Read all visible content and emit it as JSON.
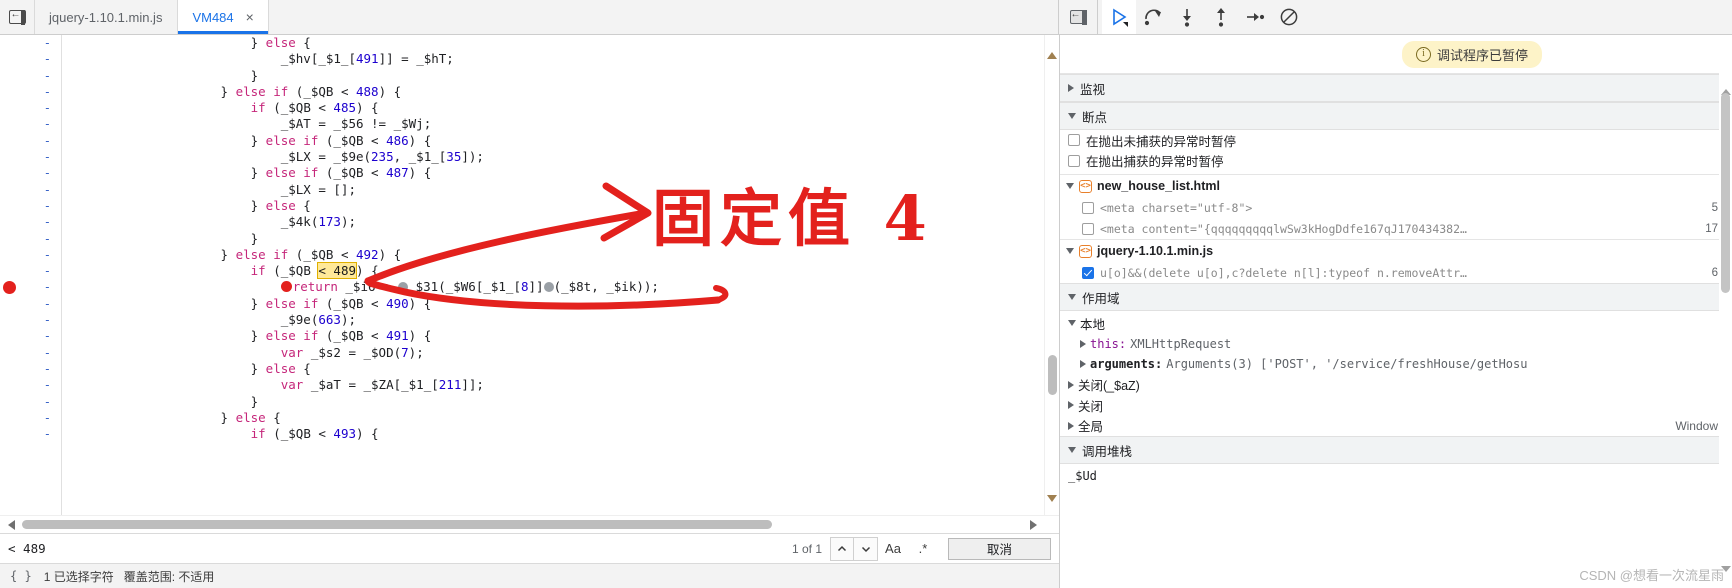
{
  "topbar": {
    "back_icon": "back-to-previous-icon",
    "tabs": [
      {
        "label": "jquery-1.10.1.min.js",
        "active": false,
        "closable": false
      },
      {
        "label": "VM484",
        "active": true,
        "closable": true,
        "close_label": "×"
      }
    ],
    "panel_toggle_icon": "show-navigator-icon",
    "debug_buttons": [
      {
        "name": "resume-script-execution",
        "icon": "play-pause-icon",
        "selected": true
      },
      {
        "name": "step-over-next-function-call",
        "icon": "step-over-icon",
        "selected": false
      },
      {
        "name": "step-into-next-function-call",
        "icon": "step-into-icon",
        "selected": false
      },
      {
        "name": "step-out-of-current-function",
        "icon": "step-out-icon",
        "selected": false
      },
      {
        "name": "step",
        "icon": "step-icon",
        "selected": false
      },
      {
        "name": "deactivate-breakpoints",
        "icon": "deactivate-breakpoints-icon",
        "selected": false
      }
    ]
  },
  "editor": {
    "lines": [
      {
        "gutter": "-",
        "segments": [
          {
            "t": "                        } ",
            "c": "punct"
          },
          {
            "t": "else",
            "c": "kw2"
          },
          {
            "t": " {",
            "c": "punct"
          }
        ]
      },
      {
        "gutter": "-",
        "segments": [
          {
            "t": "                            _$hv[_$1_[",
            "c": "punct"
          },
          {
            "t": "491",
            "c": "num"
          },
          {
            "t": "]] = _$hT;",
            "c": "punct"
          }
        ]
      },
      {
        "gutter": "-",
        "segments": [
          {
            "t": "                        }",
            "c": "punct"
          }
        ]
      },
      {
        "gutter": "-",
        "segments": [
          {
            "t": "                    } ",
            "c": "punct"
          },
          {
            "t": "else if",
            "c": "kw2"
          },
          {
            "t": " (_$QB < ",
            "c": "punct"
          },
          {
            "t": "488",
            "c": "num"
          },
          {
            "t": ") {",
            "c": "punct"
          }
        ]
      },
      {
        "gutter": "-",
        "segments": [
          {
            "t": "                        ",
            "c": "punct"
          },
          {
            "t": "if",
            "c": "kw2"
          },
          {
            "t": " (_$QB < ",
            "c": "punct"
          },
          {
            "t": "485",
            "c": "num"
          },
          {
            "t": ") {",
            "c": "punct"
          }
        ]
      },
      {
        "gutter": "-",
        "segments": [
          {
            "t": "                            _$AT = _$56 != _$Wj;",
            "c": "punct"
          }
        ]
      },
      {
        "gutter": "-",
        "segments": [
          {
            "t": "                        } ",
            "c": "punct"
          },
          {
            "t": "else if",
            "c": "kw2"
          },
          {
            "t": " (_$QB < ",
            "c": "punct"
          },
          {
            "t": "486",
            "c": "num"
          },
          {
            "t": ") {",
            "c": "punct"
          }
        ]
      },
      {
        "gutter": "-",
        "segments": [
          {
            "t": "                            _$LX = _$9e(",
            "c": "punct"
          },
          {
            "t": "235",
            "c": "num"
          },
          {
            "t": ", _$1_[",
            "c": "punct"
          },
          {
            "t": "35",
            "c": "num"
          },
          {
            "t": "]);",
            "c": "punct"
          }
        ]
      },
      {
        "gutter": "-",
        "segments": [
          {
            "t": "                        } ",
            "c": "punct"
          },
          {
            "t": "else if",
            "c": "kw2"
          },
          {
            "t": " (_$QB < ",
            "c": "punct"
          },
          {
            "t": "487",
            "c": "num"
          },
          {
            "t": ") {",
            "c": "punct"
          }
        ]
      },
      {
        "gutter": "-",
        "segments": [
          {
            "t": "                            _$LX = [];",
            "c": "punct"
          }
        ]
      },
      {
        "gutter": "-",
        "segments": [
          {
            "t": "                        } ",
            "c": "punct"
          },
          {
            "t": "else",
            "c": "kw2"
          },
          {
            "t": " {",
            "c": "punct"
          }
        ]
      },
      {
        "gutter": "-",
        "segments": [
          {
            "t": "                            _$4k(",
            "c": "punct"
          },
          {
            "t": "173",
            "c": "num"
          },
          {
            "t": ");",
            "c": "punct"
          }
        ]
      },
      {
        "gutter": "-",
        "segments": [
          {
            "t": "                        }",
            "c": "punct"
          }
        ]
      },
      {
        "gutter": "-",
        "segments": [
          {
            "t": "                    } ",
            "c": "punct"
          },
          {
            "t": "else if",
            "c": "kw2"
          },
          {
            "t": " (_$QB < ",
            "c": "punct"
          },
          {
            "t": "492",
            "c": "num"
          },
          {
            "t": ") {",
            "c": "punct"
          }
        ]
      },
      {
        "gutter": "-",
        "segments": [
          {
            "t": "                        ",
            "c": "punct"
          },
          {
            "t": "if",
            "c": "kw2"
          },
          {
            "t": " (_$QB ",
            "c": "punct"
          },
          {
            "t": "< 489",
            "c": "hl-search"
          },
          {
            "t": ") {",
            "c": "punct"
          }
        ]
      },
      {
        "gutter": "-",
        "breakpoint": true,
        "segments": [
          {
            "t": "                            ",
            "c": "punct"
          },
          {
            "t": "BPDOT",
            "c": "bpdot"
          },
          {
            "t": "return",
            "c": "ret"
          },
          {
            "t": " _$i6 + ",
            "c": "punct"
          },
          {
            "t": "DOT",
            "c": "dot"
          },
          {
            "t": "_$31(_$W6[_$1_[",
            "c": "punct"
          },
          {
            "t": "8",
            "c": "num"
          },
          {
            "t": "]]",
            "c": "punct"
          },
          {
            "t": "DOT",
            "c": "dot"
          },
          {
            "t": "(_$8t, _$ik));",
            "c": "punct"
          }
        ]
      },
      {
        "gutter": "-",
        "segments": [
          {
            "t": "                        } ",
            "c": "punct"
          },
          {
            "t": "else if",
            "c": "kw2"
          },
          {
            "t": " (_$QB < ",
            "c": "punct"
          },
          {
            "t": "490",
            "c": "num"
          },
          {
            "t": ") {",
            "c": "punct"
          }
        ]
      },
      {
        "gutter": "-",
        "segments": [
          {
            "t": "                            _$9e(",
            "c": "punct"
          },
          {
            "t": "663",
            "c": "num"
          },
          {
            "t": ");",
            "c": "punct"
          }
        ]
      },
      {
        "gutter": "-",
        "segments": [
          {
            "t": "                        } ",
            "c": "punct"
          },
          {
            "t": "else if",
            "c": "kw2"
          },
          {
            "t": " (_$QB < ",
            "c": "punct"
          },
          {
            "t": "491",
            "c": "num"
          },
          {
            "t": ") {",
            "c": "punct"
          }
        ]
      },
      {
        "gutter": "-",
        "segments": [
          {
            "t": "                            ",
            "c": "punct"
          },
          {
            "t": "var",
            "c": "kw2"
          },
          {
            "t": " _$s2 = _$OD(",
            "c": "punct"
          },
          {
            "t": "7",
            "c": "num"
          },
          {
            "t": ");",
            "c": "punct"
          }
        ]
      },
      {
        "gutter": "-",
        "segments": [
          {
            "t": "                        } ",
            "c": "punct"
          },
          {
            "t": "else",
            "c": "kw2"
          },
          {
            "t": " {",
            "c": "punct"
          }
        ]
      },
      {
        "gutter": "-",
        "segments": [
          {
            "t": "                            ",
            "c": "punct"
          },
          {
            "t": "var",
            "c": "kw2"
          },
          {
            "t": " _$aT = _$ZA[_$1_[",
            "c": "punct"
          },
          {
            "t": "211",
            "c": "num"
          },
          {
            "t": "]];",
            "c": "punct"
          }
        ]
      },
      {
        "gutter": "-",
        "segments": [
          {
            "t": "                        }",
            "c": "punct"
          }
        ]
      },
      {
        "gutter": "-",
        "segments": [
          {
            "t": "                    } ",
            "c": "punct"
          },
          {
            "t": "else",
            "c": "kw2"
          },
          {
            "t": " {",
            "c": "punct"
          }
        ]
      },
      {
        "gutter": "-",
        "segments": [
          {
            "t": "                        ",
            "c": "punct"
          },
          {
            "t": "if",
            "c": "kw2"
          },
          {
            "t": " (_$QB < ",
            "c": "punct"
          },
          {
            "t": "493",
            "c": "num"
          },
          {
            "t": ") {",
            "c": "punct"
          }
        ]
      }
    ]
  },
  "search": {
    "value": "< 489",
    "placeholder": "查找",
    "match_count": "1 of 1",
    "prev_icon": "chevron-up-icon",
    "next_icon": "chevron-down-icon",
    "match_case_label": "Aa",
    "regex_label": ".*",
    "cancel_label": "取消"
  },
  "status": {
    "format_icon": "{ }",
    "selection_text": "1 已选择字符",
    "coverage_text": "覆盖范围: 不适用"
  },
  "sidebar": {
    "paused_banner": {
      "text": "调试程序已暂停",
      "icon": "info-icon",
      "bg_color": "#fdf3c8"
    },
    "watch": {
      "title": "监视",
      "expanded": false
    },
    "breakpoints": {
      "title": "断点",
      "expanded": true,
      "options": [
        {
          "label": "在抛出未捕获的异常时暂停",
          "checked": false
        },
        {
          "label": "在抛出捕获的异常时暂停",
          "checked": false
        }
      ],
      "groups": [
        {
          "file": "new_house_list.html",
          "expanded": true,
          "items": [
            {
              "snippet": "<meta charset=\"utf-8\">",
              "line": "5",
              "checked": false
            },
            {
              "snippet": "<meta content=\"{qqqqqqqqqlwSw3kHogDdfe167qJ170434382…",
              "line": "17",
              "checked": false
            }
          ]
        },
        {
          "file": "jquery-1.10.1.min.js",
          "expanded": true,
          "items": [
            {
              "snippet": "u[o]&&(delete u[o],c?delete n[l]:typeof n.removeAttr…",
              "line": "6",
              "checked": true
            }
          ]
        }
      ]
    },
    "scope": {
      "title": "作用域",
      "expanded": true,
      "entries": [
        {
          "level": 0,
          "arrow": "down",
          "label": "本地",
          "value": "",
          "right": ""
        },
        {
          "level": 1,
          "arrow": "right",
          "label": "this:",
          "value": "XMLHttpRequest",
          "right": "",
          "name_style": "prop-name"
        },
        {
          "level": 1,
          "arrow": "right",
          "label": "arguments:",
          "value": "Arguments(3) ['POST', '/service/freshHouse/getHosu",
          "right": "",
          "name_style": "prop-name-b"
        },
        {
          "level": 0,
          "arrow": "right",
          "label": "关闭(_$aZ)",
          "value": "",
          "right": ""
        },
        {
          "level": 0,
          "arrow": "right",
          "label": "关闭",
          "value": "",
          "right": ""
        },
        {
          "level": 0,
          "arrow": "right",
          "label": "全局",
          "value": "",
          "right": "Window"
        }
      ]
    },
    "call_stack": {
      "title": "调用堆栈",
      "expanded": true,
      "frames": [
        {
          "label": "_$Ud"
        }
      ]
    }
  },
  "annotation": {
    "text": "固定值 4",
    "color": "#e3211d",
    "arrow_label": "red-arrow-annotation"
  },
  "watermark": {
    "text": "CSDN @想看一次流星雨"
  }
}
